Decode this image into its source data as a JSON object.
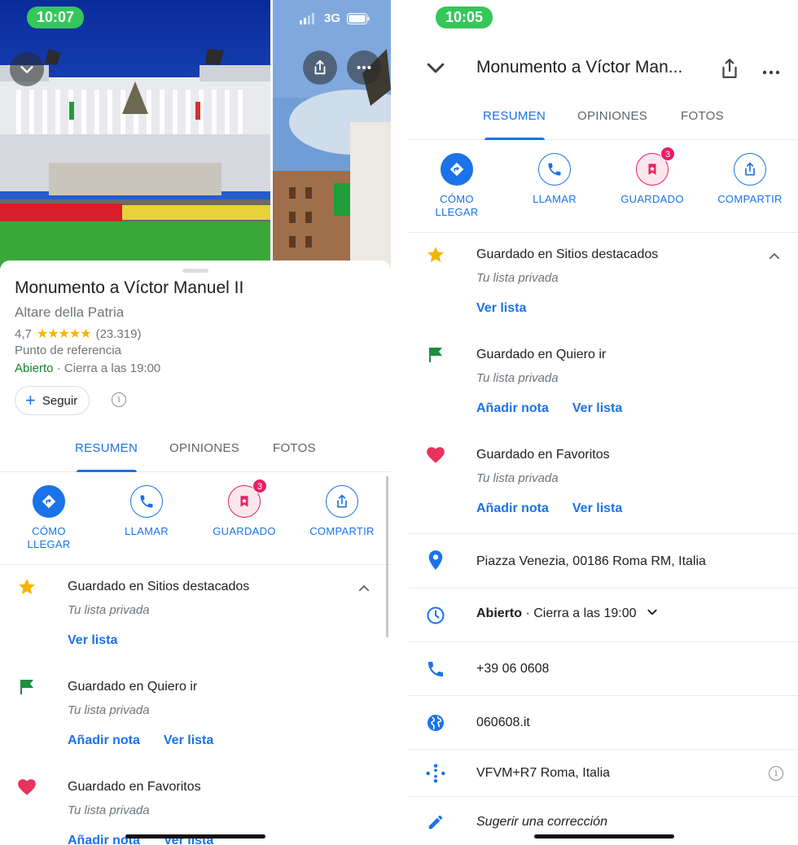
{
  "left": {
    "status_time": "10:07",
    "carrier": "3G",
    "place": {
      "title": "Monumento a Víctor Manuel II",
      "subtitle": "Altare della Patria",
      "rating": "4,7",
      "stars": "★★★★★",
      "reviews": "(23.319)",
      "category": "Punto de referencia",
      "open_status": "Abierto",
      "hours_rest": " · Cierra a las 19:00",
      "follow_label": "Seguir",
      "follow_plus": "+",
      "info_glyph": "i"
    }
  },
  "right": {
    "status_time": "10:05",
    "header_title": "Monumento a Víctor Man...",
    "details": {
      "address": "Piazza Venezia, 00186 Roma RM, Italia",
      "hours_open": "Abierto",
      "hours_rest": " · Cierra a las 19:00",
      "phone": "+39 06 0608",
      "website": "060608.it",
      "plus_code": "VFVM+R7 Roma, Italia",
      "suggest": "Sugerir una corrección",
      "info_glyph": "i"
    }
  },
  "tabs": {
    "summary": "RESUMEN",
    "reviews": "OPINIONES",
    "photos": "FOTOS"
  },
  "actions": {
    "directions_line1": "CÓMO",
    "directions_line2": "LLEGAR",
    "call": "LLAMAR",
    "saved": "GUARDADO",
    "saved_count": "3",
    "share": "COMPARTIR"
  },
  "saved_lists": {
    "featured": {
      "title": "Guardado en Sitios destacados",
      "sub": "Tu lista privada",
      "view": "Ver lista"
    },
    "want_to_go": {
      "title": "Guardado en Quiero ir",
      "sub": "Tu lista privada",
      "add_note": "Añadir nota",
      "view": "Ver lista"
    },
    "favorites": {
      "title": "Guardado en Favoritos",
      "sub": "Tu lista privada",
      "add_note": "Añadir nota",
      "view": "Ver lista"
    }
  },
  "icons": {
    "back": "chevron-down-icon",
    "share": "share-icon",
    "more": "more-horizontal-icon",
    "star": "star-icon",
    "flag": "flag-icon",
    "heart": "heart-icon",
    "pin": "location-pin-icon",
    "clock": "clock-icon",
    "phone": "phone-icon",
    "web": "globe-icon",
    "plus_code": "plus-code-icon",
    "edit": "pencil-icon"
  },
  "colors": {
    "accent": "#1a73e8",
    "open": "#188038",
    "star": "#f4b400",
    "flag": "#1e8e3e",
    "heart": "#e8335d",
    "status_pill": "#34c759"
  }
}
